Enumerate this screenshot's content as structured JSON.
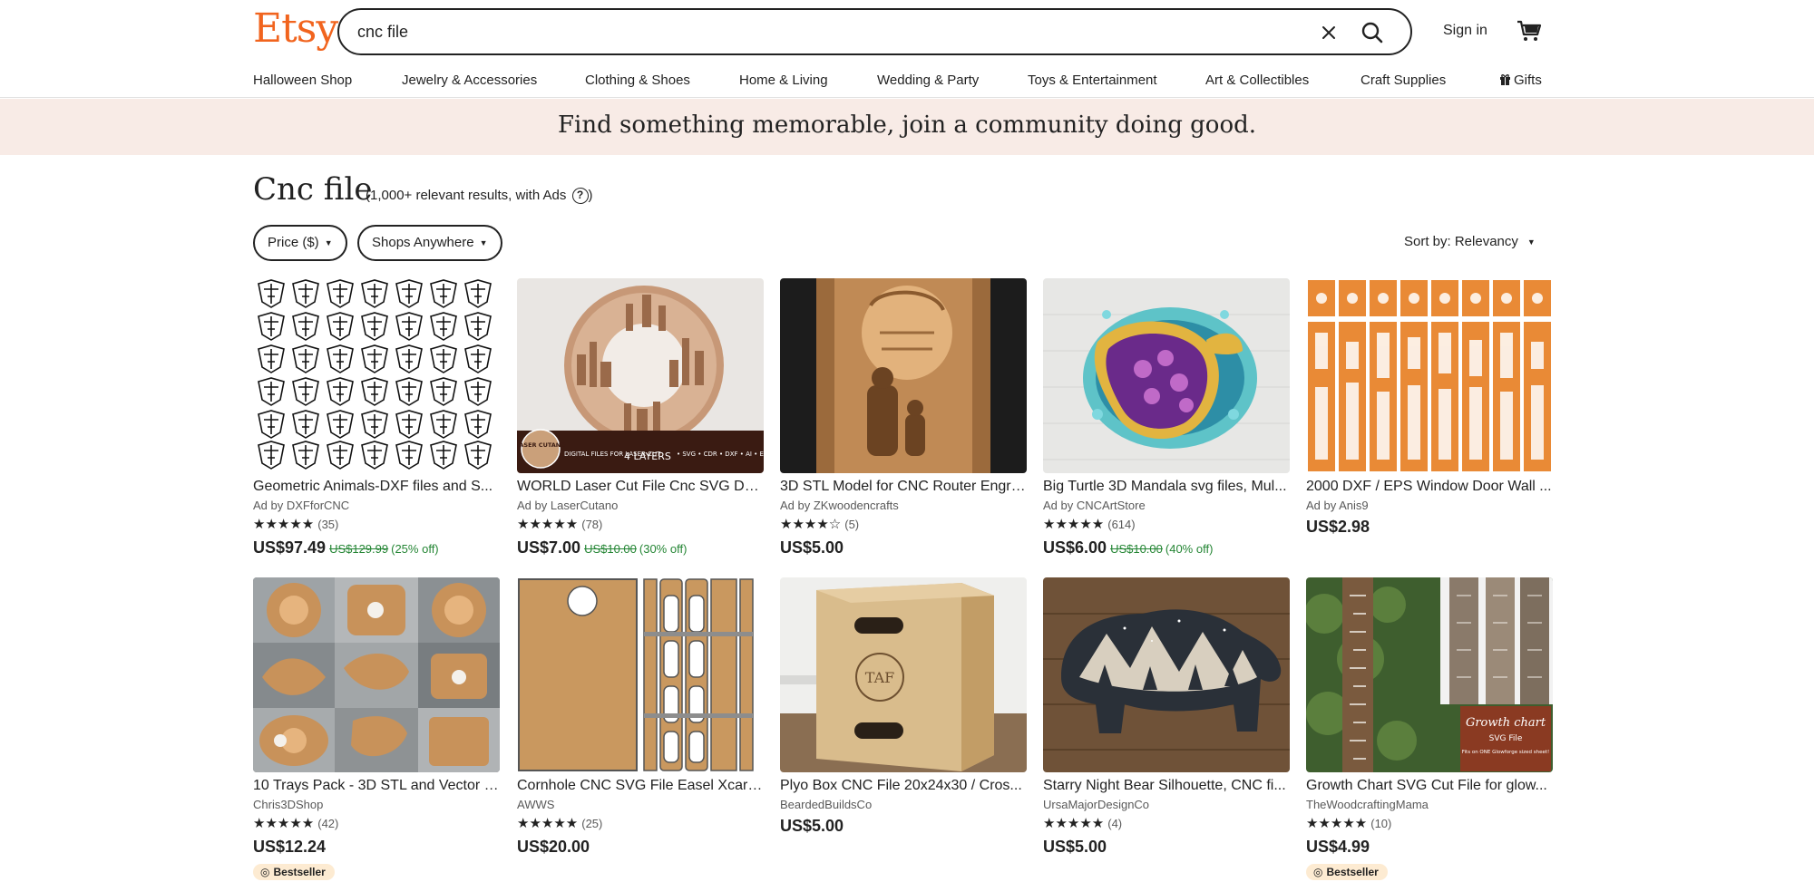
{
  "header": {
    "logo": "Etsy",
    "search_value": "cnc file",
    "sign_in": "Sign in"
  },
  "nav": [
    "Halloween Shop",
    "Jewelry & Accessories",
    "Clothing & Shoes",
    "Home & Living",
    "Wedding & Party",
    "Toys & Entertainment",
    "Art & Collectibles",
    "Craft Supplies",
    "Gifts"
  ],
  "banner": "Find something memorable, join a community doing good.",
  "search_title": "Cnc file",
  "results_text": "(1,000+ relevant results, with Ads",
  "results_close": ")",
  "filters": {
    "price": "Price ($)",
    "shops": "Shops Anywhere",
    "sort": "Sort by: Relevancy"
  },
  "colors": {
    "brand": "#f1641e",
    "sale": "#258635",
    "banner_bg": "#f8ebe6",
    "badge_bg": "#fdebd2"
  },
  "listings": [
    {
      "title": "Geometric Animals-DXF files and S...",
      "shop": "Ad by DXFforCNC",
      "stars": "★★★★★",
      "reviews": "(35)",
      "price": "US$97.49",
      "original": "US$129.99",
      "discount": "(25% off)",
      "badge": ""
    },
    {
      "title": "WORLD Laser Cut File Cnc SVG Dxf ...",
      "shop": "Ad by LaserCutano",
      "stars": "★★★★★",
      "reviews": "(78)",
      "price": "US$7.00",
      "original": "US$10.00",
      "discount": "(30% off)",
      "badge": ""
    },
    {
      "title": "3D STL Model for CNC Router Engra...",
      "shop": "Ad by ZKwoodencrafts",
      "stars": "★★★★☆",
      "reviews": "(5)",
      "price": "US$5.00",
      "original": "",
      "discount": "",
      "badge": ""
    },
    {
      "title": "Big Turtle 3D Mandala svg files, Mul...",
      "shop": "Ad by CNCArtStore",
      "stars": "★★★★★",
      "reviews": "(614)",
      "price": "US$6.00",
      "original": "US$10.00",
      "discount": "(40% off)",
      "badge": ""
    },
    {
      "title": "2000 DXF / EPS Window Door Wall ...",
      "shop": "Ad by Anis9",
      "stars": "",
      "reviews": "",
      "price": "US$2.98",
      "original": "",
      "discount": "",
      "badge": ""
    },
    {
      "title": "10 Trays Pack - 3D STL and Vector Fi...",
      "shop": "Chris3DShop",
      "stars": "★★★★★",
      "reviews": "(42)",
      "price": "US$12.24",
      "original": "",
      "discount": "",
      "badge": "Bestseller"
    },
    {
      "title": "Cornhole CNC SVG File Easel Xcarv...",
      "shop": "AWWS",
      "stars": "★★★★★",
      "reviews": "(25)",
      "price": "US$20.00",
      "original": "",
      "discount": "",
      "badge": ""
    },
    {
      "title": "Plyo Box CNC File 20x24x30 / Cros...",
      "shop": "BeardedBuildsCo",
      "stars": "",
      "reviews": "",
      "price": "US$5.00",
      "original": "",
      "discount": "",
      "badge": ""
    },
    {
      "title": "Starry Night Bear Silhouette, CNC fi...",
      "shop": "UrsaMajorDesignCo",
      "stars": "★★★★★",
      "reviews": "(4)",
      "price": "US$5.00",
      "original": "",
      "discount": "",
      "badge": ""
    },
    {
      "title": "Growth Chart SVG Cut File for glow...",
      "shop": "TheWoodcraftingMama",
      "stars": "★★★★★",
      "reviews": "(10)",
      "price": "US$4.99",
      "original": "",
      "discount": "",
      "badge": "Bestseller"
    }
  ],
  "image_text": {
    "laser_badge": "LASER CUTANO",
    "digital_files": "DIGITAL FILES FOR LASER CUT",
    "layers": "4 LAYERS",
    "formats": "• SVG • CDR • DXF • AI • EPS • PDF • DWG",
    "taf": "TAF",
    "growth_title": "Growth chart",
    "growth_sub": "SVG File",
    "growth_note": "Fits on ONE Glowforge sized sheet!"
  }
}
